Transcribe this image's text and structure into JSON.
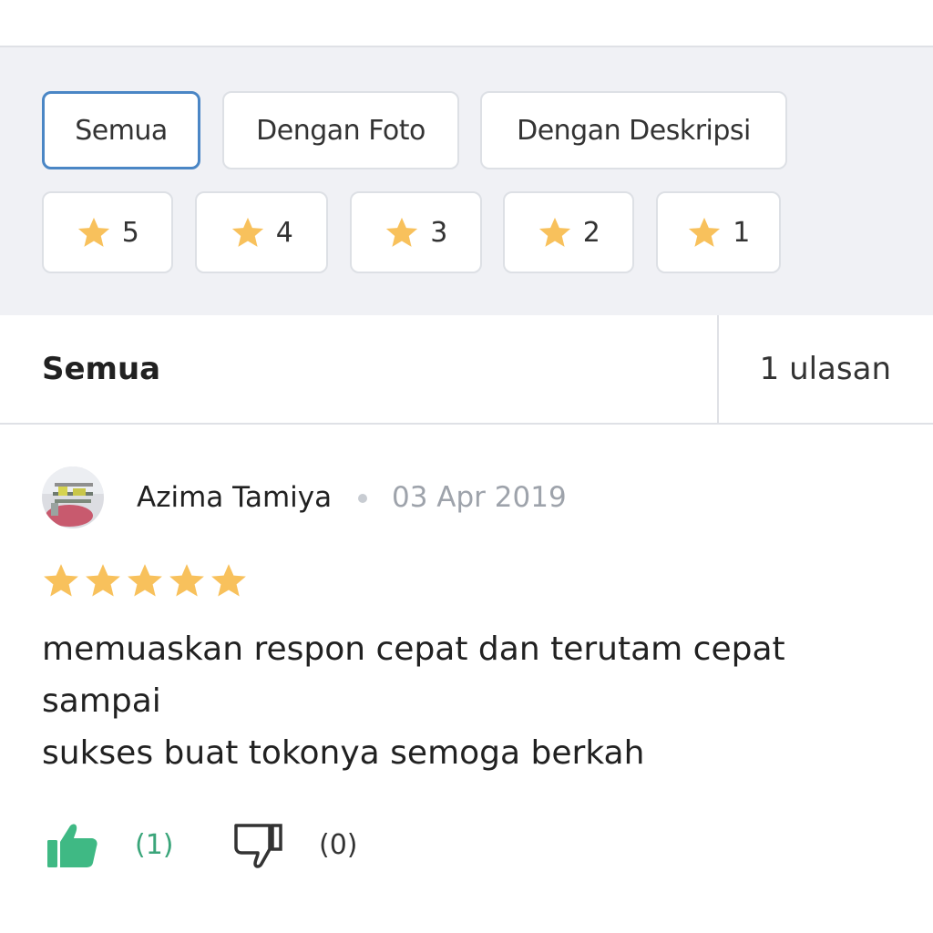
{
  "filters": {
    "type_chips": [
      {
        "label": "Semua",
        "active": true
      },
      {
        "label": "Dengan Foto",
        "active": false
      },
      {
        "label": "Dengan Deskripsi",
        "active": false
      }
    ],
    "star_chips": [
      {
        "label": "5",
        "icon": "star-icon"
      },
      {
        "label": "4",
        "icon": "star-icon"
      },
      {
        "label": "3",
        "icon": "star-icon"
      },
      {
        "label": "2",
        "icon": "star-icon"
      },
      {
        "label": "1",
        "icon": "star-icon"
      }
    ]
  },
  "summary": {
    "title": "Semua",
    "count": "1 ulasan"
  },
  "review": {
    "reviewer": "Azima Tamiya",
    "date": "03 Apr 2019",
    "rating": 5,
    "text": "memuaskan respon cepat dan terutam cepat\nsampai\nsukses buat tokonya semoga berkah",
    "likes": "(1)",
    "dislikes": "(0)"
  },
  "colors": {
    "star": "#f8c15c",
    "like": "#3fb984",
    "active_border": "#4a86c5",
    "panel_bg": "#f0f1f5"
  }
}
